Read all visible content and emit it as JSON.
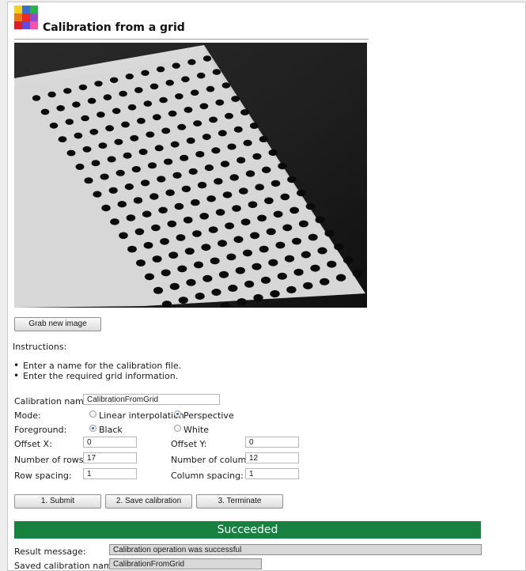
{
  "header": {
    "title": "Calibration from a grid"
  },
  "camera": {
    "grid_rows": 17,
    "grid_cols": 12
  },
  "buttons": {
    "grab": "Grab new image",
    "submit": "1. Submit",
    "save": "2. Save calibration",
    "terminate": "3. Terminate"
  },
  "instructions": {
    "label": "Instructions:",
    "items": [
      "Enter a name for the calibration file.",
      "Enter the required grid information."
    ]
  },
  "form": {
    "calibration_name_label": "Calibration name:",
    "calibration_name_value": "CalibrationFromGrid",
    "mode_label": "Mode:",
    "mode_linear": "Linear interpolation",
    "mode_perspective": "Perspective",
    "foreground_label": "Foreground:",
    "foreground_black": "Black",
    "foreground_white": "White",
    "offset_x_label": "Offset X:",
    "offset_x_value": "0",
    "offset_y_label": "Offset Y:",
    "offset_y_value": "0",
    "rows_label": "Number of rows:",
    "rows_value": "17",
    "cols_label": "Number of columns:",
    "cols_value": "12",
    "row_spacing_label": "Row spacing:",
    "row_spacing_value": "1",
    "col_spacing_label": "Column spacing:",
    "col_spacing_value": "1"
  },
  "status": {
    "text": "Succeeded",
    "color": "#17813f"
  },
  "result": {
    "message_label": "Result message:",
    "message_value": "Calibration operation was successful",
    "saved_label": "Saved calibration name:",
    "saved_value": "CalibrationFromGrid"
  }
}
